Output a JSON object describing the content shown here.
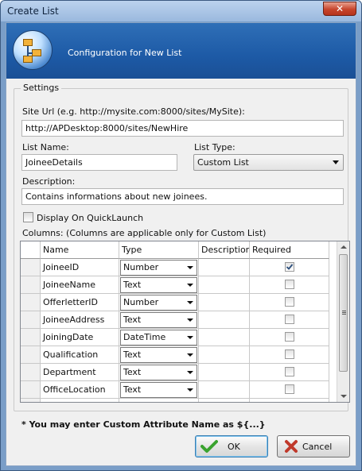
{
  "window": {
    "title": "Create List",
    "close_glyph": "✕"
  },
  "header": {
    "title": "Configuration for New List",
    "icon": "list-structure-icon"
  },
  "settings": {
    "group_label": "Settings",
    "site_url_label": "Site Url (e.g. http://mysite.com:8000/sites/MySite):",
    "site_url_value": "http://APDesktop:8000/sites/NewHire",
    "list_name_label": "List Name:",
    "list_name_value": "JoineeDetails",
    "list_type_label": "List Type:",
    "list_type_value": "Custom List",
    "description_label": "Description:",
    "description_value": "Contains informations about new joinees.",
    "quicklaunch_label": "Display On QuickLaunch",
    "quicklaunch_checked": false,
    "columns_label": "Columns: (Columns are applicable only for Custom List)"
  },
  "grid": {
    "headers": {
      "name": "Name",
      "type": "Type",
      "description": "Description",
      "required": "Required"
    },
    "rows": [
      {
        "name": "JoineeID",
        "type": "Number",
        "required": true
      },
      {
        "name": "JoineeName",
        "type": "Text",
        "required": false
      },
      {
        "name": "OfferletterID",
        "type": "Number",
        "required": false
      },
      {
        "name": "JoineeAddress",
        "type": "Text",
        "required": false
      },
      {
        "name": "JoiningDate",
        "type": "DateTime",
        "required": false
      },
      {
        "name": "Qualification",
        "type": "Text",
        "required": false
      },
      {
        "name": "Department",
        "type": "Text",
        "required": false
      },
      {
        "name": "OfficeLocation",
        "type": "Text",
        "required": false
      }
    ]
  },
  "note": "* You may enter Custom Attribute Name as ${...}",
  "buttons": {
    "ok": "OK",
    "cancel": "Cancel"
  },
  "colors": {
    "header_blue": "#1d5aa6",
    "ok_icon": "#3aa32f",
    "cancel_icon": "#c0392b"
  }
}
